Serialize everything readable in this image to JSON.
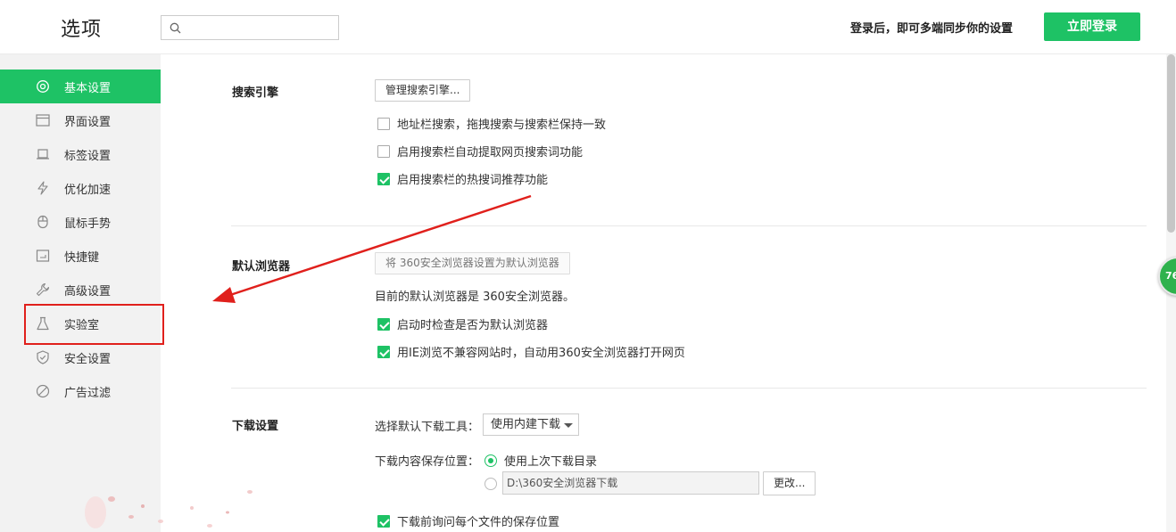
{
  "header": {
    "title": "选项",
    "search_placeholder": "",
    "sync_hint": "登录后，即可多端同步你的设置",
    "login_button": "立即登录"
  },
  "sidebar": {
    "items": [
      {
        "label": "基本设置",
        "icon": "gear-icon",
        "active": true
      },
      {
        "label": "界面设置",
        "icon": "window-icon",
        "active": false
      },
      {
        "label": "标签设置",
        "icon": "tab-icon",
        "active": false
      },
      {
        "label": "优化加速",
        "icon": "lightning-icon",
        "active": false
      },
      {
        "label": "鼠标手势",
        "icon": "mouse-icon",
        "active": false
      },
      {
        "label": "快捷键",
        "icon": "keyboard-icon",
        "active": false
      },
      {
        "label": "高级设置",
        "icon": "wrench-icon",
        "active": false
      },
      {
        "label": "实验室",
        "icon": "flask-icon",
        "active": false
      },
      {
        "label": "安全设置",
        "icon": "shield-icon",
        "active": false
      },
      {
        "label": "广告过滤",
        "icon": "block-icon",
        "active": false
      }
    ]
  },
  "search_engine": {
    "title": "搜索引擎",
    "manage_button": "管理搜索引擎...",
    "options": [
      {
        "label": "地址栏搜索，拖拽搜索与搜索栏保持一致",
        "checked": false
      },
      {
        "label": "启用搜索栏自动提取网页搜索词功能",
        "checked": false
      },
      {
        "label": "启用搜索栏的热搜词推荐功能",
        "checked": true
      }
    ]
  },
  "default_browser": {
    "title": "默认浏览器",
    "set_default_button": "将 360安全浏览器设置为默认浏览器",
    "status_text": "目前的默认浏览器是 360安全浏览器。",
    "options": [
      {
        "label": "启动时检查是否为默认浏览器",
        "checked": true
      },
      {
        "label": "用IE浏览不兼容网站时，自动用360安全浏览器打开网页",
        "checked": true
      }
    ]
  },
  "download": {
    "title": "下载设置",
    "tool_label": "选择默认下载工具：",
    "tool_selected": "使用内建下载",
    "location_label": "下载内容保存位置：",
    "radio_last": "使用上次下载目录",
    "radio_last_checked": true,
    "path_value": "D:\\360安全浏览器下载",
    "change_button": "更改...",
    "ask_option": {
      "label": "下载前询问每个文件的保存位置",
      "checked": true
    }
  },
  "floating_badge": "76",
  "colors": {
    "accent": "#1ec265",
    "highlight": "#e0201c"
  }
}
